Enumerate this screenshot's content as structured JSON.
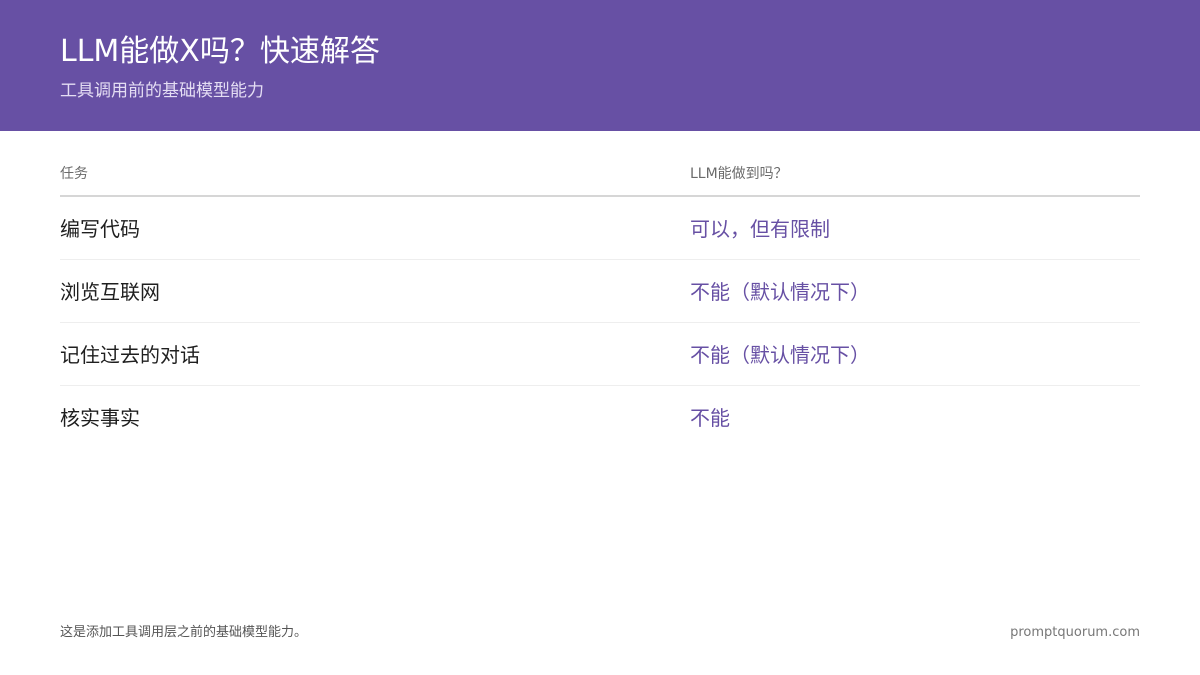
{
  "header": {
    "title": "LLM能做X吗？快速解答",
    "subtitle": "工具调用前的基础模型能力",
    "background_color": "#6750a4"
  },
  "table": {
    "columns": [
      "任务",
      "LLM能做到吗？"
    ],
    "rows": [
      {
        "task": "编写代码",
        "answer": "可以，但有限制"
      },
      {
        "task": "浏览互联网",
        "answer": "不能（默认情况下）"
      },
      {
        "task": "记住过去的对话",
        "answer": "不能（默认情况下）"
      },
      {
        "task": "核实事实",
        "answer": "不能"
      }
    ],
    "answer_color": "#6750a4"
  },
  "footer": {
    "note": "这是添加工具调用层之前的基础模型能力。",
    "site": "promptquorum.com"
  }
}
